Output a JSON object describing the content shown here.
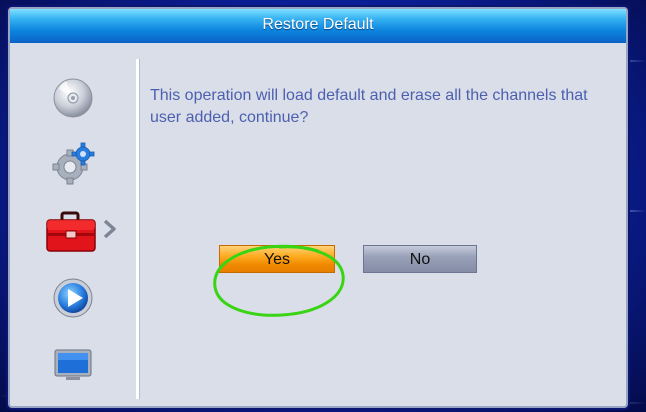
{
  "dialog": {
    "title": "Restore Default",
    "message": "This operation will load default and erase all the channels that user added, continue?",
    "buttons": {
      "yes_label": "Yes",
      "no_label": "No"
    },
    "selected_button": "yes"
  },
  "sidebar": {
    "items": [
      {
        "icon": "disc-icon"
      },
      {
        "icon": "gear-icon"
      },
      {
        "icon": "toolbox-icon",
        "selected": true
      },
      {
        "icon": "play-icon"
      },
      {
        "icon": "screen-icon"
      }
    ]
  },
  "annotation": {
    "shape": "hand-drawn circle",
    "color": "#39d414",
    "target": "yes-button"
  },
  "colors": {
    "title_bar": "#0d86df",
    "panel_background": "#d9dee8",
    "message_text": "#4d5fb0",
    "yes_button": "#f5960f",
    "no_button": "#9aa2ba",
    "background": "#0b1f9a"
  }
}
